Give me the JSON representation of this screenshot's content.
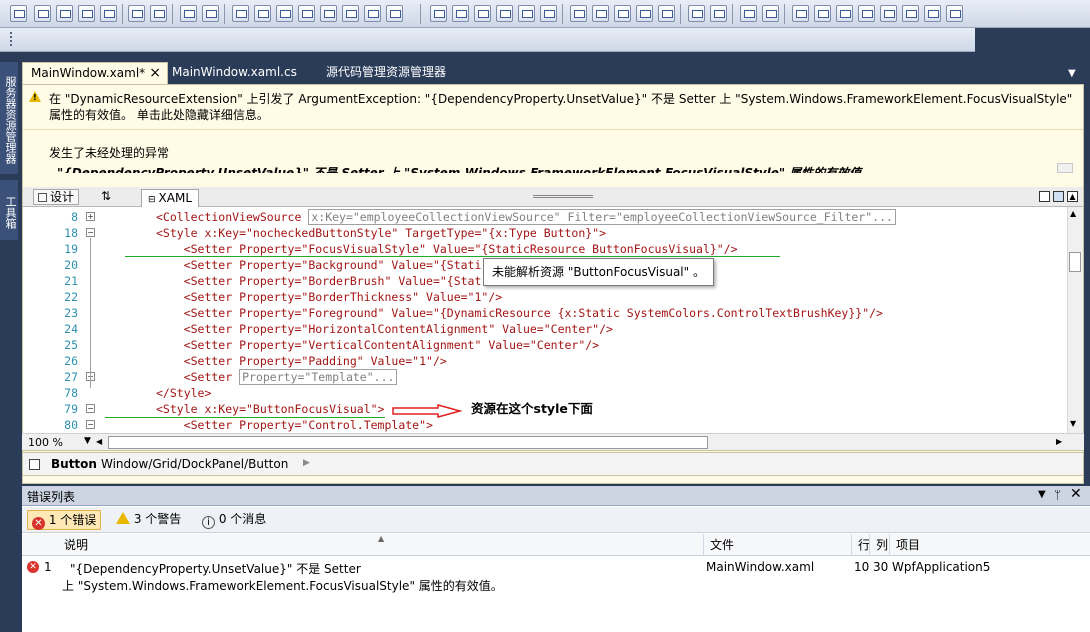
{
  "editor": {
    "tabs": [
      {
        "label": "MainWindow.xaml*",
        "close": "×"
      },
      {
        "label": "MainWindow.xaml.cs"
      },
      {
        "label": "源代码管理资源管理器"
      }
    ],
    "side_tabs": [
      "服务器资源管理器",
      "工具箱"
    ],
    "exception_banner": {
      "message": "在 \"DynamicResourceExtension\" 上引发了 ArgumentException: \"{DependencyProperty.UnsetValue}\" 不是 Setter 上 \"System.Windows.FrameworkElement.FocusVisualStyle\" 属性的有效值。 单击此处隐藏详细信息。",
      "heading": "发生了未经处理的异常",
      "detail_partial": "\"{DependencyProperty.UnsetValue}\" 不是 Setter 上 \"System.Windows.FrameworkElement.FocusVisualStyle\" 属性的有效值。"
    },
    "view_tabs": {
      "design": "设计",
      "swap": "⇅",
      "xaml": "XAML"
    },
    "code_lines": [
      {
        "num": "8",
        "text": "<CollectionViewSource",
        "collapsed": "x:Key=\"employeeCollectionViewSource\" Filter=\"employeeCollectionViewSource_Filter\"..."
      },
      {
        "num": "18",
        "text": "<Style x:Key=\"nocheckedButtonStyle\" TargetType=\"{x:Type Button}\">"
      },
      {
        "num": "19",
        "text": "    <Setter Property=\"FocusVisualStyle\" Value=\"{StaticResource ButtonFocusVisual}\"/>"
      },
      {
        "num": "20",
        "text": "    <Setter Property=\"Background\" Value=\"{Stati"
      },
      {
        "num": "21",
        "text": "    <Setter Property=\"BorderBrush\" Value=\"{Stat"
      },
      {
        "num": "22",
        "text": "    <Setter Property=\"BorderThickness\" Value=\"1\"/>"
      },
      {
        "num": "23",
        "text": "    <Setter Property=\"Foreground\" Value=\"{DynamicResource {x:Static SystemColors.ControlTextBrushKey}}\"/>"
      },
      {
        "num": "24",
        "text": "    <Setter Property=\"HorizontalContentAlignment\" Value=\"Center\"/>"
      },
      {
        "num": "25",
        "text": "    <Setter Property=\"VerticalContentAlignment\" Value=\"Center\"/>"
      },
      {
        "num": "26",
        "text": "    <Setter Property=\"Padding\" Value=\"1\"/>"
      },
      {
        "num": "27",
        "text": "    <Setter",
        "collapsed": "Property=\"Template\"..."
      },
      {
        "num": "78",
        "text": "</Style>"
      },
      {
        "num": "79",
        "text": "<Style x:Key=\"ButtonFocusVisual\">"
      },
      {
        "num": "80",
        "text": "    <Setter Property=\"Control.Template\">"
      }
    ],
    "tooltip": "未能解析资源 \"ButtonFocusVisual\" 。",
    "annotation": "资源在这个style下面",
    "zoom": "100 %",
    "breadcrumb": {
      "element": "Button",
      "path": "Window/Grid/DockPanel/Button"
    }
  },
  "error_list": {
    "title": "错误列表",
    "filters": {
      "errors": "1 个错误",
      "warnings": "3 个警告",
      "messages": "0 个消息"
    },
    "columns": [
      "说明",
      "文件",
      "行",
      "列",
      "项目"
    ],
    "rows": [
      {
        "index": "1",
        "desc1": "\"{DependencyProperty.UnsetValue}\" 不是 Setter",
        "desc2": "上 \"System.Windows.FrameworkElement.FocusVisualStyle\" 属性的有效值。",
        "file": "MainWindow.xaml",
        "line": "10",
        "col": "30",
        "project": "WpfApplication5"
      }
    ]
  },
  "colors": {
    "chrome": "#2b3c59",
    "banner": "#fffbe6",
    "error": "#d9342b",
    "link_arrow": "#e02020"
  }
}
